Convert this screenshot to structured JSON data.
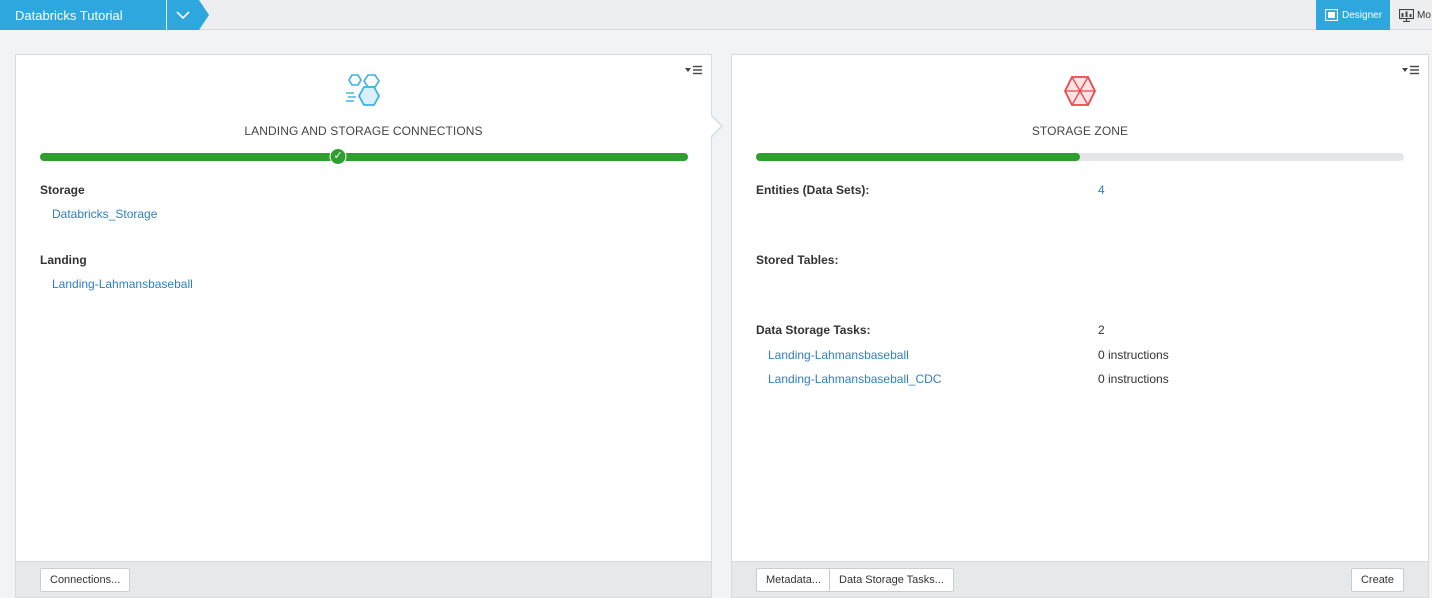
{
  "topbar": {
    "project_name": "Databricks Tutorial",
    "designer_label": "Designer",
    "monitor_label": "Mo"
  },
  "left_panel": {
    "title": "LANDING AND STORAGE CONNECTIONS",
    "progress": 1.0,
    "check_position": 0.46,
    "storage_label": "Storage",
    "storage_link": "Databricks_Storage",
    "landing_label": "Landing",
    "landing_link": "Landing-Lahmansbaseball",
    "connections_button": "Connections..."
  },
  "right_panel": {
    "title": "STORAGE ZONE",
    "progress": 0.5,
    "entities_label": "Entities (Data Sets):",
    "entities_value": "4",
    "stored_tables_label": "Stored Tables:",
    "tasks_label": "Data Storage Tasks:",
    "tasks_count": "2",
    "tasks": [
      {
        "name": "Landing-Lahmansbaseball",
        "instructions": "0 instructions"
      },
      {
        "name": "Landing-Lahmansbaseball_CDC",
        "instructions": "0 instructions"
      }
    ],
    "metadata_button": "Metadata...",
    "data_storage_tasks_button": "Data Storage Tasks...",
    "create_button": "Create"
  },
  "colors": {
    "accent": "#2ea7de",
    "progress_green": "#2f9e2f",
    "link": "#2f7fc1",
    "storage_zone_icon": "#e8474a",
    "connections_icon": "#3bb1e0"
  },
  "icons": {
    "project_dropdown": "chevron-down-icon",
    "designer": "designer-icon",
    "monitor": "monitor-icon",
    "panel_menu": "panel-menu-icon",
    "left_panel": "hexagon-cluster-icon",
    "right_panel": "storage-zone-hexagon-icon"
  }
}
